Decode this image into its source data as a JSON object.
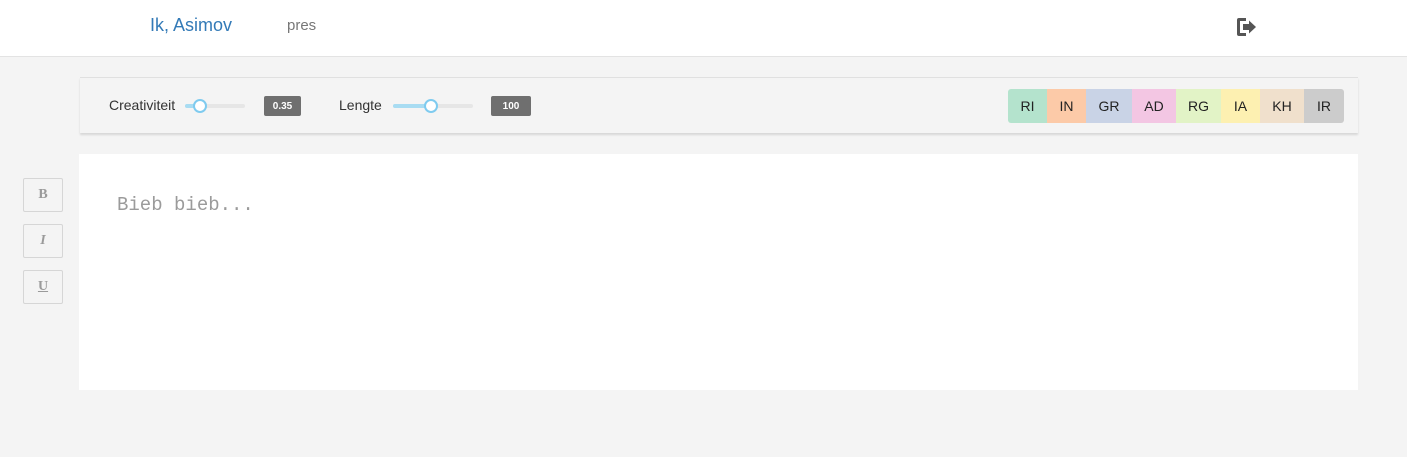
{
  "navbar": {
    "brand": "Ik, Asimov",
    "link": "pres",
    "logout_icon": "sign-out-icon"
  },
  "toolbar": {
    "creativity": {
      "label": "Creativiteit",
      "value": "0.35",
      "fraction": 0.25
    },
    "length": {
      "label": "Lengte",
      "value": "100",
      "fraction": 0.48
    },
    "tags": [
      {
        "label": "RI",
        "color": "#b4e3cd"
      },
      {
        "label": "IN",
        "color": "#fccaa8"
      },
      {
        "label": "GR",
        "color": "#c9d3e6"
      },
      {
        "label": "AD",
        "color": "#f3c6e3"
      },
      {
        "label": "RG",
        "color": "#e2f3c6"
      },
      {
        "label": "IA",
        "color": "#fdf0b1"
      },
      {
        "label": "KH",
        "color": "#f0e0cc"
      },
      {
        "label": "IR",
        "color": "#cccccc"
      }
    ]
  },
  "format_buttons": {
    "bold": "B",
    "italic": "I",
    "underline": "U"
  },
  "editor": {
    "placeholder": "Bieb bieb..."
  },
  "colors": {
    "brand": "#337ab7",
    "slider_accent": "#7fcbef",
    "badge": "#6f6f6f"
  }
}
